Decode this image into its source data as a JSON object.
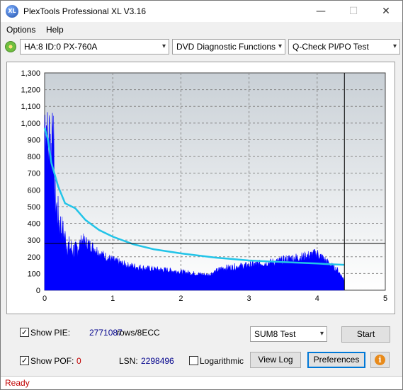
{
  "window": {
    "title": "PlexTools Professional XL V3.16",
    "app_icon_text": "XL",
    "minimize_glyph": "—",
    "maximize_glyph": "☐",
    "close_glyph": "✕"
  },
  "menu": {
    "options": "Options",
    "help": "Help"
  },
  "toolbar": {
    "drive": "HA:8 ID:0  PX-760A",
    "function": "DVD Diagnostic Functions",
    "test": "Q-Check PI/PO Test",
    "arrow_glyph": "▾"
  },
  "chart_data": {
    "type": "area",
    "x_ticks": [
      "0",
      "1",
      "2",
      "3",
      "4",
      "5"
    ],
    "y_ticks": [
      "0",
      "100",
      "200",
      "300",
      "400",
      "500",
      "600",
      "700",
      "800",
      "900",
      "1,000",
      "1,100",
      "1,200",
      "1,300"
    ],
    "xlim": [
      0,
      5
    ],
    "ylim": [
      0,
      1300
    ],
    "grid": true,
    "end_marker_x": 4.4,
    "threshold_y": 280,
    "colors": {
      "bars": "#0000ff",
      "average": "#22c4e8",
      "plot_bg_top": "#c9d0d6",
      "plot_bg_bottom": "#ffffff",
      "grid": "#8a8a8a"
    },
    "pie_profile": {
      "x": [
        0.0,
        0.02,
        0.05,
        0.08,
        0.1,
        0.12,
        0.14,
        0.18,
        0.22,
        0.28,
        0.35,
        0.45,
        0.55,
        0.7,
        0.85,
        1.0,
        1.2,
        1.5,
        1.8,
        2.0,
        2.2,
        2.4,
        2.6,
        2.8,
        3.0,
        3.2,
        3.4,
        3.6,
        3.8,
        4.0,
        4.2,
        4.3,
        4.4
      ],
      "y": [
        1000,
        1050,
        820,
        980,
        760,
        1200,
        600,
        480,
        400,
        330,
        260,
        230,
        300,
        260,
        210,
        180,
        150,
        130,
        120,
        110,
        100,
        90,
        130,
        140,
        150,
        160,
        170,
        190,
        200,
        220,
        150,
        120,
        60
      ]
    },
    "avg_line": {
      "x": [
        0.0,
        0.05,
        0.1,
        0.2,
        0.3,
        0.45,
        0.6,
        0.8,
        1.0,
        1.3,
        1.6,
        2.0,
        2.5,
        3.0,
        3.5,
        4.0,
        4.2,
        4.4
      ],
      "y": [
        970,
        900,
        760,
        620,
        520,
        490,
        420,
        360,
        320,
        275,
        245,
        220,
        195,
        178,
        168,
        160,
        155,
        152
      ]
    }
  },
  "controls": {
    "show_pie_label": "Show PIE:",
    "show_pie_value": "2771087",
    "rows_label": "rows/8ECC",
    "show_pof_label": "Show POF:",
    "show_pof_value": "0",
    "lsn_label": "LSN:",
    "lsn_value": "2298496",
    "logarithmic_label": "Logarithmic",
    "test_select": "SUM8 Test",
    "start_button": "Start",
    "view_log_button": "View Log",
    "preferences_button": "Preferences",
    "checkmark": "✓",
    "info_glyph": "i"
  },
  "status": {
    "text": "Ready"
  }
}
